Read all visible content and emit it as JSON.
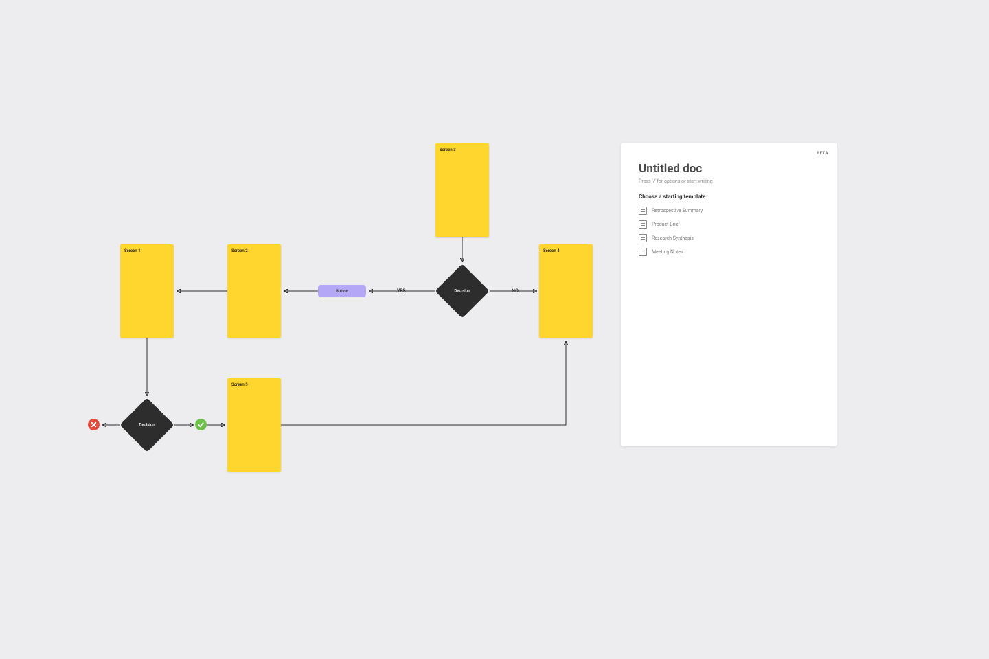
{
  "flow": {
    "screens": {
      "s1": "Screen 1",
      "s2": "Screen 2",
      "s3": "Screen 3",
      "s4": "Screen 4",
      "s5": "Screen 5"
    },
    "decisions": {
      "top": "Decision",
      "bottom": "Decision"
    },
    "button": "Button",
    "edge_labels": {
      "yes": "YES",
      "no": "NO"
    }
  },
  "doc": {
    "badge": "BETA",
    "title": "Untitled doc",
    "hint": "Press '/' for options or start writing",
    "section": "Choose a starting template",
    "templates": [
      "Retrospective Summary",
      "Product Brief",
      "Research Synthesis",
      "Meeting Notes"
    ]
  }
}
